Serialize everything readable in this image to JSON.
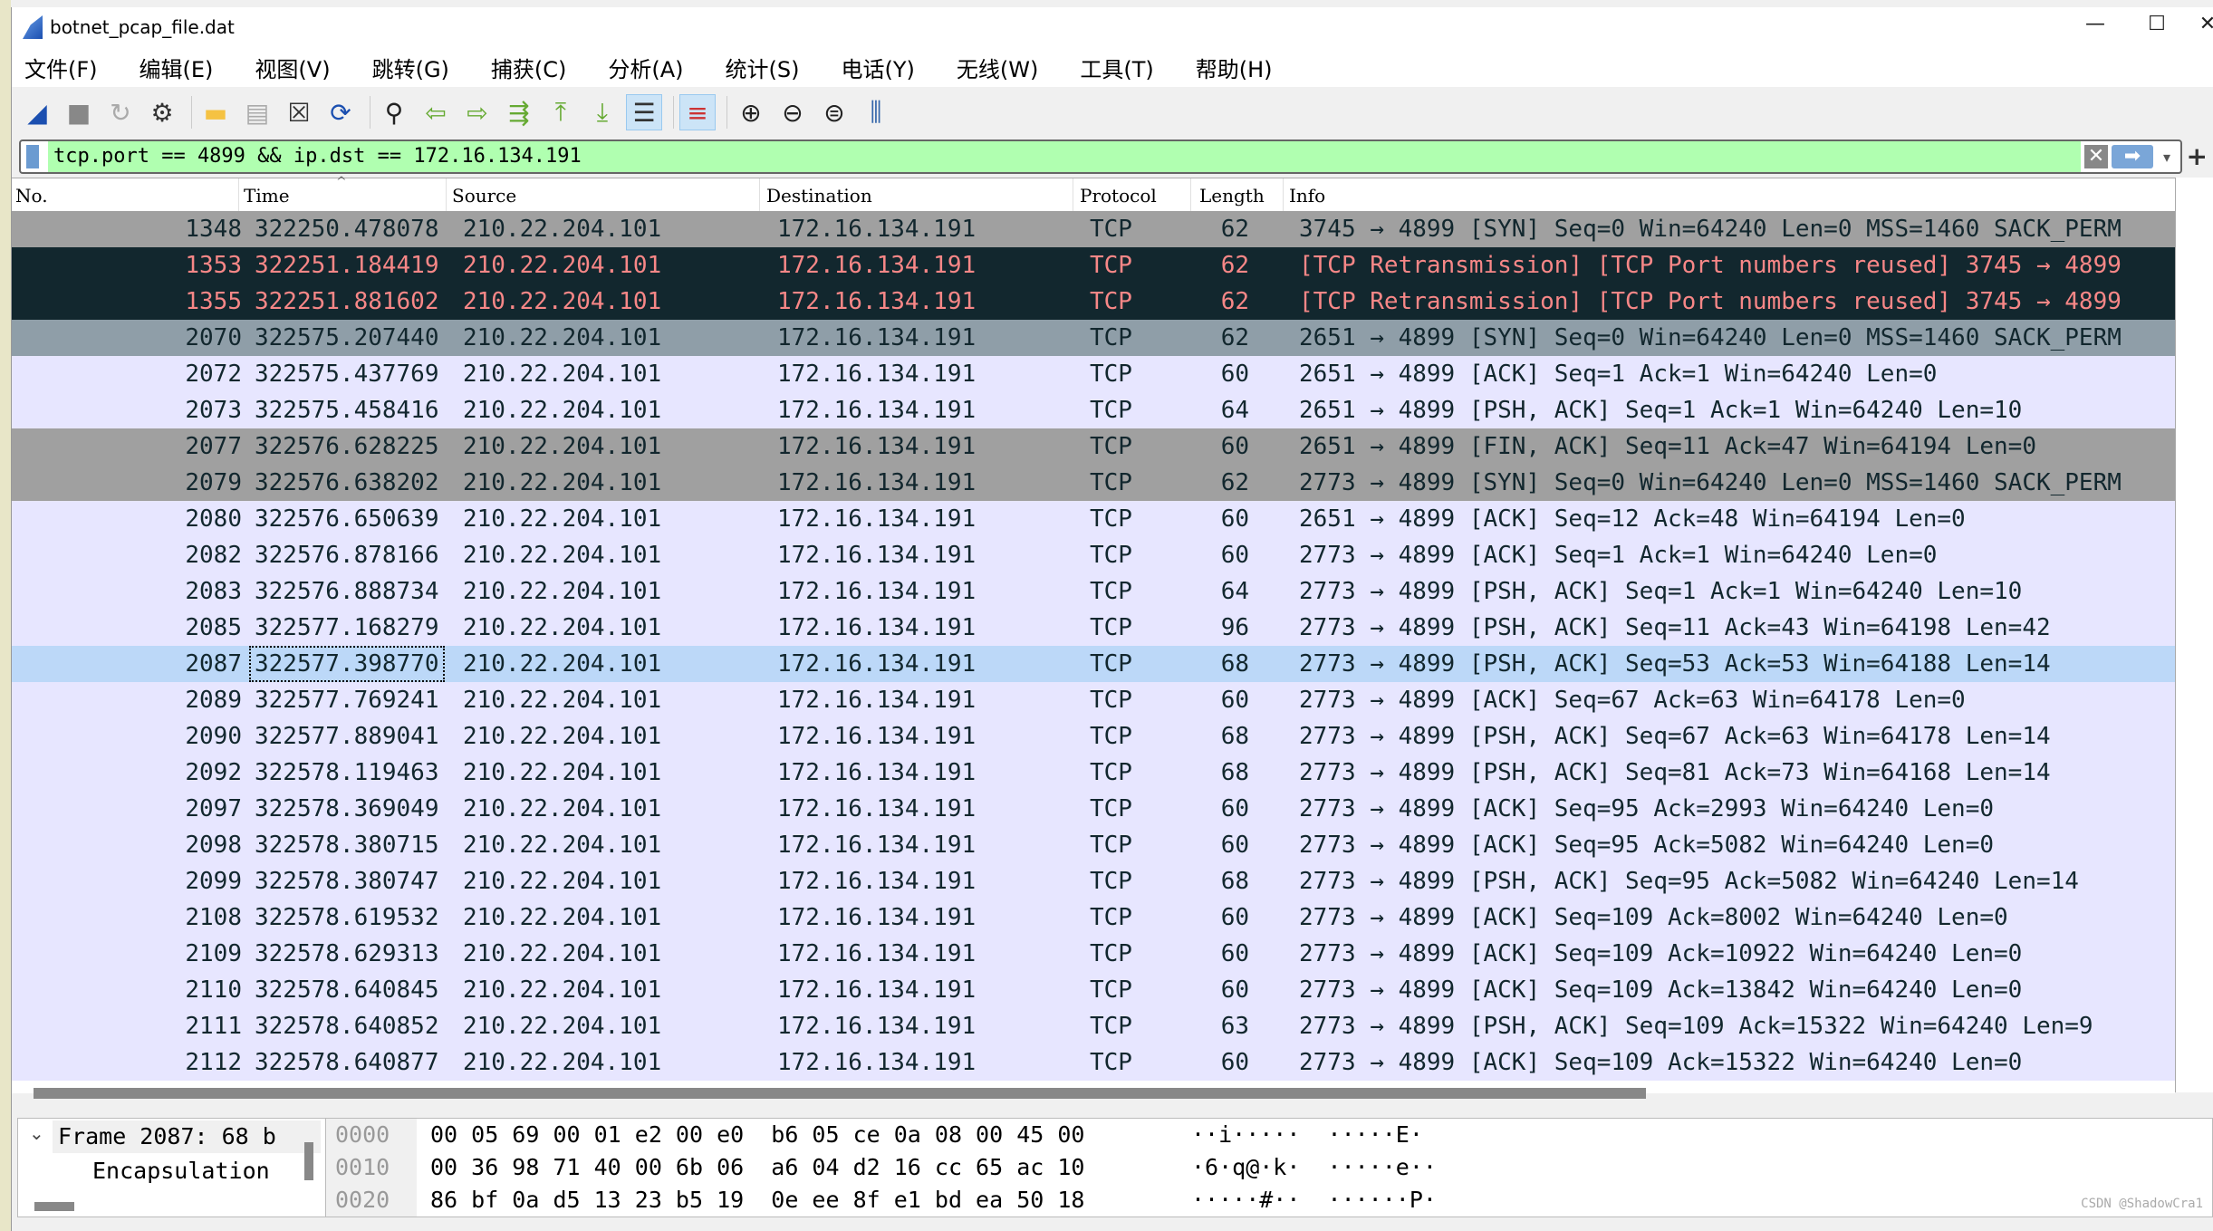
{
  "window": {
    "title": "botnet_pcap_file.dat",
    "minimize": "—",
    "maximize": "☐",
    "close": "✕"
  },
  "menu": [
    "文件(F)",
    "编辑(E)",
    "视图(V)",
    "跳转(G)",
    "捕获(C)",
    "分析(A)",
    "统计(S)",
    "电话(Y)",
    "无线(W)",
    "工具(T)",
    "帮助(H)"
  ],
  "toolbar": [
    {
      "icon": "shark-fin-start-icon",
      "glyph": "◢",
      "color": "#1b4fb0"
    },
    {
      "icon": "stop-icon",
      "glyph": "■",
      "color": "#888"
    },
    {
      "icon": "restart-icon",
      "glyph": "↻",
      "color": "#aaa"
    },
    {
      "icon": "options-gear-icon",
      "glyph": "⚙",
      "color": "#333"
    },
    {
      "sep": true
    },
    {
      "icon": "open-folder-icon",
      "glyph": "▬",
      "color": "#f5c242"
    },
    {
      "icon": "save-file-icon",
      "glyph": "▤",
      "color": "#aaa"
    },
    {
      "icon": "close-file-icon",
      "glyph": "☒",
      "color": "#333"
    },
    {
      "icon": "reload-icon",
      "glyph": "⟳",
      "color": "#1b4fb0"
    },
    {
      "sep": true
    },
    {
      "icon": "find-icon",
      "glyph": "⚲",
      "color": "#222"
    },
    {
      "icon": "back-arrow-icon",
      "glyph": "⇦",
      "color": "#6a3"
    },
    {
      "icon": "forward-arrow-icon",
      "glyph": "⇨",
      "color": "#6a3"
    },
    {
      "icon": "go-to-packet-icon",
      "glyph": "⇶",
      "color": "#6a3"
    },
    {
      "icon": "first-packet-icon",
      "glyph": "⤒",
      "color": "#6a3"
    },
    {
      "icon": "last-packet-icon",
      "glyph": "⤓",
      "color": "#6a3"
    },
    {
      "icon": "autoscroll-icon",
      "glyph": "☰",
      "color": "#333",
      "active": true
    },
    {
      "sep": true
    },
    {
      "icon": "colorize-icon",
      "glyph": "≡",
      "color": "#c33",
      "active": true
    },
    {
      "sep": true
    },
    {
      "icon": "zoom-in-icon",
      "glyph": "⊕",
      "color": "#222"
    },
    {
      "icon": "zoom-out-icon",
      "glyph": "⊖",
      "color": "#222"
    },
    {
      "icon": "zoom-reset-icon",
      "glyph": "⊜",
      "color": "#222"
    },
    {
      "icon": "resize-columns-icon",
      "glyph": "⫼",
      "color": "#36a"
    }
  ],
  "filter": {
    "value": "tcp.port == 4899 && ip.dst == 172.16.134.191",
    "clear": "✕",
    "apply": "➡",
    "dropdown": "▾",
    "add": "+"
  },
  "columns": [
    "No.",
    "Time",
    "Source",
    "Destination",
    "Protocol",
    "Length",
    "Info"
  ],
  "sort_indicator": "^",
  "row_colors": {
    "gray": "#a0a0a0",
    "dark": "#12272e",
    "dark_text": "#f78787",
    "syn": "#8f9ea8",
    "light": "#e7e6ff",
    "selected": "#bcd8f8",
    "text": "#12272e"
  },
  "packets": [
    {
      "no": "1348",
      "time": "322250.478078",
      "src": "210.22.204.101",
      "dst": "172.16.134.191",
      "proto": "TCP",
      "len": "62",
      "info": "3745 → 4899 [SYN] Seq=0 Win=64240 Len=0 MSS=1460 SACK_PERM",
      "style": "gray"
    },
    {
      "no": "1353",
      "time": "322251.184419",
      "src": "210.22.204.101",
      "dst": "172.16.134.191",
      "proto": "TCP",
      "len": "62",
      "info": "[TCP Retransmission] [TCP Port numbers reused] 3745 → 4899",
      "style": "dark"
    },
    {
      "no": "1355",
      "time": "322251.881602",
      "src": "210.22.204.101",
      "dst": "172.16.134.191",
      "proto": "TCP",
      "len": "62",
      "info": "[TCP Retransmission] [TCP Port numbers reused] 3745 → 4899",
      "style": "dark"
    },
    {
      "no": "2070",
      "time": "322575.207440",
      "src": "210.22.204.101",
      "dst": "172.16.134.191",
      "proto": "TCP",
      "len": "62",
      "info": "2651 → 4899 [SYN] Seq=0 Win=64240 Len=0 MSS=1460 SACK_PERM",
      "style": "syn"
    },
    {
      "no": "2072",
      "time": "322575.437769",
      "src": "210.22.204.101",
      "dst": "172.16.134.191",
      "proto": "TCP",
      "len": "60",
      "info": "2651 → 4899 [ACK] Seq=1 Ack=1 Win=64240 Len=0",
      "style": "light"
    },
    {
      "no": "2073",
      "time": "322575.458416",
      "src": "210.22.204.101",
      "dst": "172.16.134.191",
      "proto": "TCP",
      "len": "64",
      "info": "2651 → 4899 [PSH, ACK] Seq=1 Ack=1 Win=64240 Len=10",
      "style": "light"
    },
    {
      "no": "2077",
      "time": "322576.628225",
      "src": "210.22.204.101",
      "dst": "172.16.134.191",
      "proto": "TCP",
      "len": "60",
      "info": "2651 → 4899 [FIN, ACK] Seq=11 Ack=47 Win=64194 Len=0",
      "style": "gray"
    },
    {
      "no": "2079",
      "time": "322576.638202",
      "src": "210.22.204.101",
      "dst": "172.16.134.191",
      "proto": "TCP",
      "len": "62",
      "info": "2773 → 4899 [SYN] Seq=0 Win=64240 Len=0 MSS=1460 SACK_PERM",
      "style": "gray"
    },
    {
      "no": "2080",
      "time": "322576.650639",
      "src": "210.22.204.101",
      "dst": "172.16.134.191",
      "proto": "TCP",
      "len": "60",
      "info": "2651 → 4899 [ACK] Seq=12 Ack=48 Win=64194 Len=0",
      "style": "light"
    },
    {
      "no": "2082",
      "time": "322576.878166",
      "src": "210.22.204.101",
      "dst": "172.16.134.191",
      "proto": "TCP",
      "len": "60",
      "info": "2773 → 4899 [ACK] Seq=1 Ack=1 Win=64240 Len=0",
      "style": "light"
    },
    {
      "no": "2083",
      "time": "322576.888734",
      "src": "210.22.204.101",
      "dst": "172.16.134.191",
      "proto": "TCP",
      "len": "64",
      "info": "2773 → 4899 [PSH, ACK] Seq=1 Ack=1 Win=64240 Len=10",
      "style": "light"
    },
    {
      "no": "2085",
      "time": "322577.168279",
      "src": "210.22.204.101",
      "dst": "172.16.134.191",
      "proto": "TCP",
      "len": "96",
      "info": "2773 → 4899 [PSH, ACK] Seq=11 Ack=43 Win=64198 Len=42",
      "style": "light"
    },
    {
      "no": "2087",
      "time": "322577.398770",
      "src": "210.22.204.101",
      "dst": "172.16.134.191",
      "proto": "TCP",
      "len": "68",
      "info": "2773 → 4899 [PSH, ACK] Seq=53 Ack=53 Win=64188 Len=14",
      "style": "selected"
    },
    {
      "no": "2089",
      "time": "322577.769241",
      "src": "210.22.204.101",
      "dst": "172.16.134.191",
      "proto": "TCP",
      "len": "60",
      "info": "2773 → 4899 [ACK] Seq=67 Ack=63 Win=64178 Len=0",
      "style": "light"
    },
    {
      "no": "2090",
      "time": "322577.889041",
      "src": "210.22.204.101",
      "dst": "172.16.134.191",
      "proto": "TCP",
      "len": "68",
      "info": "2773 → 4899 [PSH, ACK] Seq=67 Ack=63 Win=64178 Len=14",
      "style": "light"
    },
    {
      "no": "2092",
      "time": "322578.119463",
      "src": "210.22.204.101",
      "dst": "172.16.134.191",
      "proto": "TCP",
      "len": "68",
      "info": "2773 → 4899 [PSH, ACK] Seq=81 Ack=73 Win=64168 Len=14",
      "style": "light"
    },
    {
      "no": "2097",
      "time": "322578.369049",
      "src": "210.22.204.101",
      "dst": "172.16.134.191",
      "proto": "TCP",
      "len": "60",
      "info": "2773 → 4899 [ACK] Seq=95 Ack=2993 Win=64240 Len=0",
      "style": "light"
    },
    {
      "no": "2098",
      "time": "322578.380715",
      "src": "210.22.204.101",
      "dst": "172.16.134.191",
      "proto": "TCP",
      "len": "60",
      "info": "2773 → 4899 [ACK] Seq=95 Ack=5082 Win=64240 Len=0",
      "style": "light"
    },
    {
      "no": "2099",
      "time": "322578.380747",
      "src": "210.22.204.101",
      "dst": "172.16.134.191",
      "proto": "TCP",
      "len": "68",
      "info": "2773 → 4899 [PSH, ACK] Seq=95 Ack=5082 Win=64240 Len=14",
      "style": "light"
    },
    {
      "no": "2108",
      "time": "322578.619532",
      "src": "210.22.204.101",
      "dst": "172.16.134.191",
      "proto": "TCP",
      "len": "60",
      "info": "2773 → 4899 [ACK] Seq=109 Ack=8002 Win=64240 Len=0",
      "style": "light"
    },
    {
      "no": "2109",
      "time": "322578.629313",
      "src": "210.22.204.101",
      "dst": "172.16.134.191",
      "proto": "TCP",
      "len": "60",
      "info": "2773 → 4899 [ACK] Seq=109 Ack=10922 Win=64240 Len=0",
      "style": "light"
    },
    {
      "no": "2110",
      "time": "322578.640845",
      "src": "210.22.204.101",
      "dst": "172.16.134.191",
      "proto": "TCP",
      "len": "60",
      "info": "2773 → 4899 [ACK] Seq=109 Ack=13842 Win=64240 Len=0",
      "style": "light"
    },
    {
      "no": "2111",
      "time": "322578.640852",
      "src": "210.22.204.101",
      "dst": "172.16.134.191",
      "proto": "TCP",
      "len": "63",
      "info": "2773 → 4899 [PSH, ACK] Seq=109 Ack=15322 Win=64240 Len=9",
      "style": "light"
    },
    {
      "no": "2112",
      "time": "322578.640877",
      "src": "210.22.204.101",
      "dst": "172.16.134.191",
      "proto": "TCP",
      "len": "60",
      "info": "2773 → 4899 [ACK] Seq=109 Ack=15322 Win=64240 Len=0",
      "style": "light"
    }
  ],
  "details": {
    "expand": "⌄",
    "items": [
      "Frame 2087: 68 b",
      "Encapsulation"
    ]
  },
  "hex": [
    {
      "offset": "0000",
      "bytes": "00 05 69 00 01 e2 00 e0  b6 05 ce 0a 08 00 45 00",
      "ascii": "··i·····  ·····E·"
    },
    {
      "offset": "0010",
      "bytes": "00 36 98 71 40 00 6b 06  a6 04 d2 16 cc 65 ac 10",
      "ascii": "·6·q@·k·  ·····e··"
    },
    {
      "offset": "0020",
      "bytes": "86 bf 0a d5 13 23 b5 19  0e ee 8f e1 bd ea 50 18",
      "ascii": "·····#··  ······P·"
    }
  ],
  "watermark": "CSDN @ShadowCra1"
}
